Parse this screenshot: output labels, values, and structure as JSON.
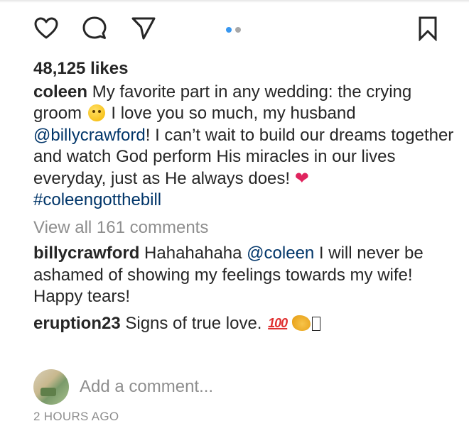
{
  "actions": {
    "like_icon": "heart-outline-icon",
    "comment_icon": "comment-bubble-icon",
    "share_icon": "paper-plane-icon",
    "save_icon": "bookmark-icon",
    "carousel": {
      "total": 2,
      "active_index": 0
    },
    "accent_color": "#3897f0"
  },
  "post": {
    "likes": "48,125 likes",
    "caption": {
      "username": "coleen",
      "text_1": " My favorite part in any wedding: the crying groom ",
      "emoji_1": "face-emoji",
      "text_2": " I love you so much, my husband ",
      "mention": "@billycrawford",
      "text_3": "! I can’t wait to build our dreams together and watch God perform His miracles in our lives everyday, just as He always does! ",
      "emoji_2": "heart-emoji",
      "hashtag": "#coleengotthebill"
    },
    "view_all_comments": "View all 161 comments",
    "comments": [
      {
        "username": "billycrawford",
        "text_1": " Hahahahaha ",
        "mention": "@coleen",
        "text_2": " I will never be ashamed of showing my feelings towards my wife! Happy tears!"
      },
      {
        "username": "eruption23",
        "text": " Signs of true love. ",
        "emoji_1": "hundred-points-emoji",
        "emoji_2": "flexed-biceps-emoji"
      }
    ],
    "add_comment_placeholder": "Add a comment...",
    "timestamp": "2 HOURS AGO",
    "mention_color": "#003569"
  }
}
